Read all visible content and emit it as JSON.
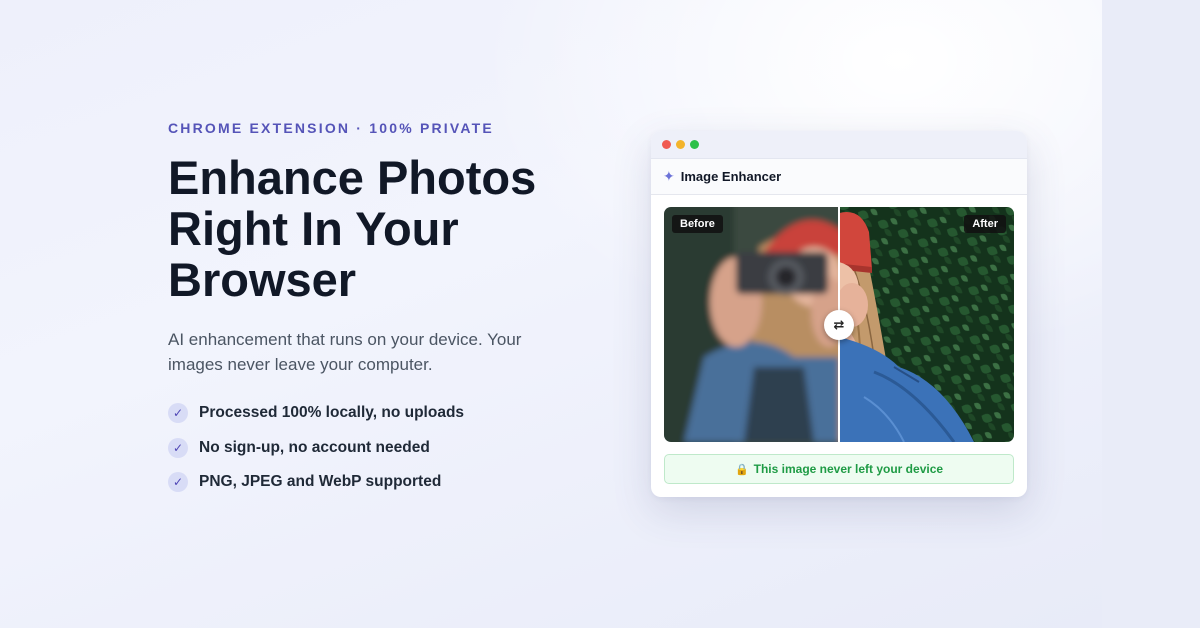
{
  "hero": {
    "eyebrow": "CHROME EXTENSION · 100% PRIVATE",
    "headline_lines": [
      "Enhance Photos",
      "Right In Your",
      "Browser"
    ],
    "subtext": "AI enhancement that runs on your device. Your images never leave your computer.",
    "features": [
      "Processed 100% locally, no uploads",
      "No sign-up, no account needed",
      "PNG, JPEG and WebP supported"
    ],
    "check_glyph": "✓"
  },
  "app": {
    "title": "Image Enhancer",
    "sparkle_glyph": "✦",
    "before_label": "Before",
    "after_label": "After",
    "swap_glyph": "⇄",
    "privacy_message": "This image never left your device",
    "lock_glyph": "🔒"
  },
  "colors": {
    "accent": "#5554b8",
    "headline": "#111827",
    "success": "#1f9b45"
  }
}
